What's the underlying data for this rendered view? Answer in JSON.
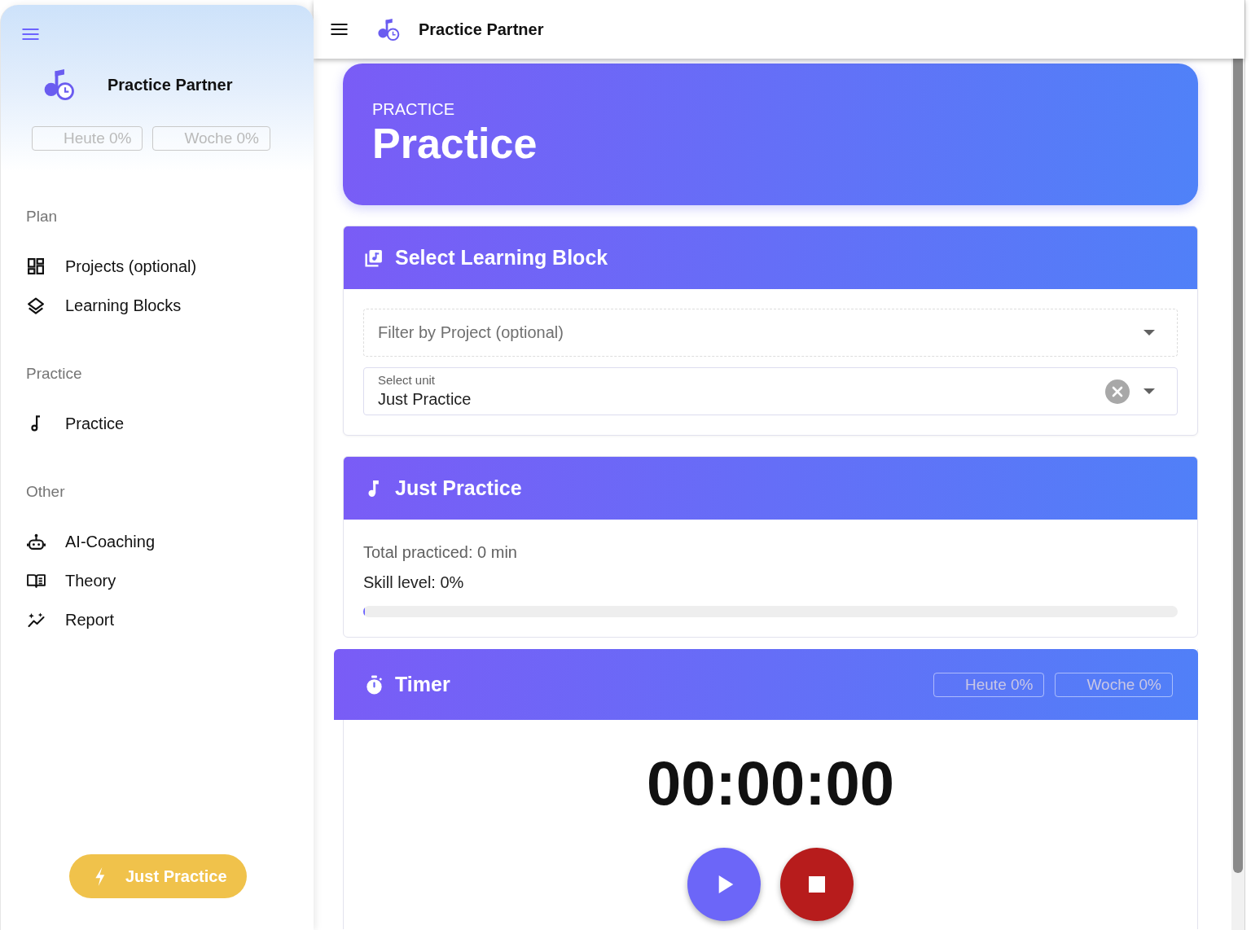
{
  "sidebar": {
    "app_name": "Practice Partner",
    "stats": [
      {
        "label": "Heute 0%"
      },
      {
        "label": "Woche 0%"
      }
    ],
    "sections": [
      {
        "title": "Plan",
        "items": [
          {
            "label": "Projects (optional)",
            "selected": false
          },
          {
            "label": "Learning Blocks",
            "selected": false
          }
        ]
      },
      {
        "title": "Practice",
        "items": [
          {
            "label": "Practice",
            "selected": false
          }
        ]
      },
      {
        "title": "Other",
        "items": [
          {
            "label": "AI-Coaching",
            "selected": false
          },
          {
            "label": "Theory",
            "selected": false
          },
          {
            "label": "Report",
            "selected": false
          }
        ]
      }
    ],
    "action_button": {
      "label": "Just Practice"
    }
  },
  "top_bar": {
    "title": "Practice Partner"
  },
  "hero": {
    "overline": "PRACTICE",
    "title": "Practice"
  },
  "select_card": {
    "title": "Select Learning Block",
    "filter": {
      "placeholder": "Filter by Project (optional)"
    },
    "unit": {
      "label": "Select unit",
      "value": "Just Practice"
    }
  },
  "block_card": {
    "title": "Just Practice",
    "total": "Total practiced: 0 min",
    "skill": "Skill level: 0%",
    "progress": {
      "level": 0
    }
  },
  "timer_card": {
    "title": "Timer",
    "stats": [
      {
        "label": "Heute 0%"
      },
      {
        "label": "Woche 0%"
      }
    ],
    "time": "00:00:00"
  }
}
